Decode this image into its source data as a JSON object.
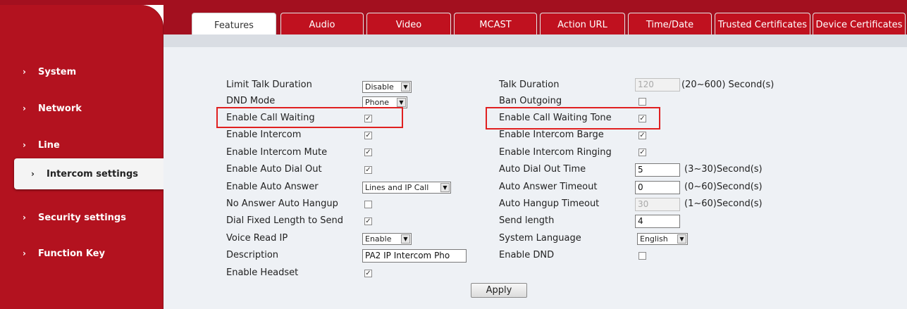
{
  "sidebar": {
    "items": [
      {
        "label": "System",
        "chevron": "›"
      },
      {
        "label": "Network",
        "chevron": "›"
      },
      {
        "label": "Line",
        "chevron": "›"
      },
      {
        "label": "Intercom settings",
        "chevron": "›",
        "active": true
      },
      {
        "label": "Security settings",
        "chevron": "›"
      },
      {
        "label": "Function Key",
        "chevron": "›"
      }
    ]
  },
  "tabs": [
    {
      "label": "Features",
      "active": true
    },
    {
      "label": "Audio"
    },
    {
      "label": "Video"
    },
    {
      "label": "MCAST"
    },
    {
      "label": "Action URL"
    },
    {
      "label": "Time/Date"
    },
    {
      "label": "Trusted Certificates"
    },
    {
      "label": "Device Certificates"
    }
  ],
  "form": {
    "left": [
      {
        "label": "Limit Talk Duration",
        "type": "select",
        "value": "Disable"
      },
      {
        "label": "DND Mode",
        "type": "select",
        "value": "Phone"
      },
      {
        "label": "Enable Call Waiting",
        "type": "checkbox",
        "checked": true
      },
      {
        "label": "Enable Intercom",
        "type": "checkbox",
        "checked": true
      },
      {
        "label": "Enable Intercom Mute",
        "type": "checkbox",
        "checked": true
      },
      {
        "label": "Enable Auto Dial Out",
        "type": "checkbox",
        "checked": true
      },
      {
        "label": "Enable Auto Answer",
        "type": "select",
        "value": "Lines and IP Call"
      },
      {
        "label": "No Answer Auto Hangup",
        "type": "checkbox",
        "checked": false
      },
      {
        "label": "Dial Fixed Length to Send",
        "type": "checkbox",
        "checked": true
      },
      {
        "label": "Voice Read IP",
        "type": "select",
        "value": "Enable"
      },
      {
        "label": "Description",
        "type": "text",
        "value": "PA2 IP Intercom Pho"
      },
      {
        "label": "Enable Headset",
        "type": "checkbox",
        "checked": true
      }
    ],
    "right": [
      {
        "label": "Talk Duration",
        "type": "text",
        "value": "120",
        "disabled": true,
        "unit": "(20~600) Second(s)"
      },
      {
        "label": "Ban Outgoing",
        "type": "checkbox",
        "checked": false
      },
      {
        "label": "Enable Call Waiting Tone",
        "type": "checkbox",
        "checked": true
      },
      {
        "label": "Enable Intercom Barge",
        "type": "checkbox",
        "checked": true
      },
      {
        "label": "Enable Intercom Ringing",
        "type": "checkbox",
        "checked": true
      },
      {
        "label": "Auto Dial Out Time",
        "type": "text",
        "value": "5",
        "unit": "(3~30)Second(s)"
      },
      {
        "label": "Auto Answer Timeout",
        "type": "text",
        "value": "0",
        "unit": "(0~60)Second(s)"
      },
      {
        "label": "Auto Hangup Timeout",
        "type": "text",
        "value": "30",
        "disabled": true,
        "unit": "(1~60)Second(s)"
      },
      {
        "label": "Send length",
        "type": "text",
        "value": "4"
      },
      {
        "label": "System Language",
        "type": "select",
        "value": "English"
      },
      {
        "label": "Enable DND",
        "type": "checkbox",
        "checked": false
      }
    ],
    "apply_label": "Apply",
    "check_glyph": "✓",
    "dropdown_glyph": "▼"
  },
  "colors": {
    "brand_red": "#b3121f",
    "highlight_box": "#e02020",
    "content_bg": "#eef1f5"
  }
}
